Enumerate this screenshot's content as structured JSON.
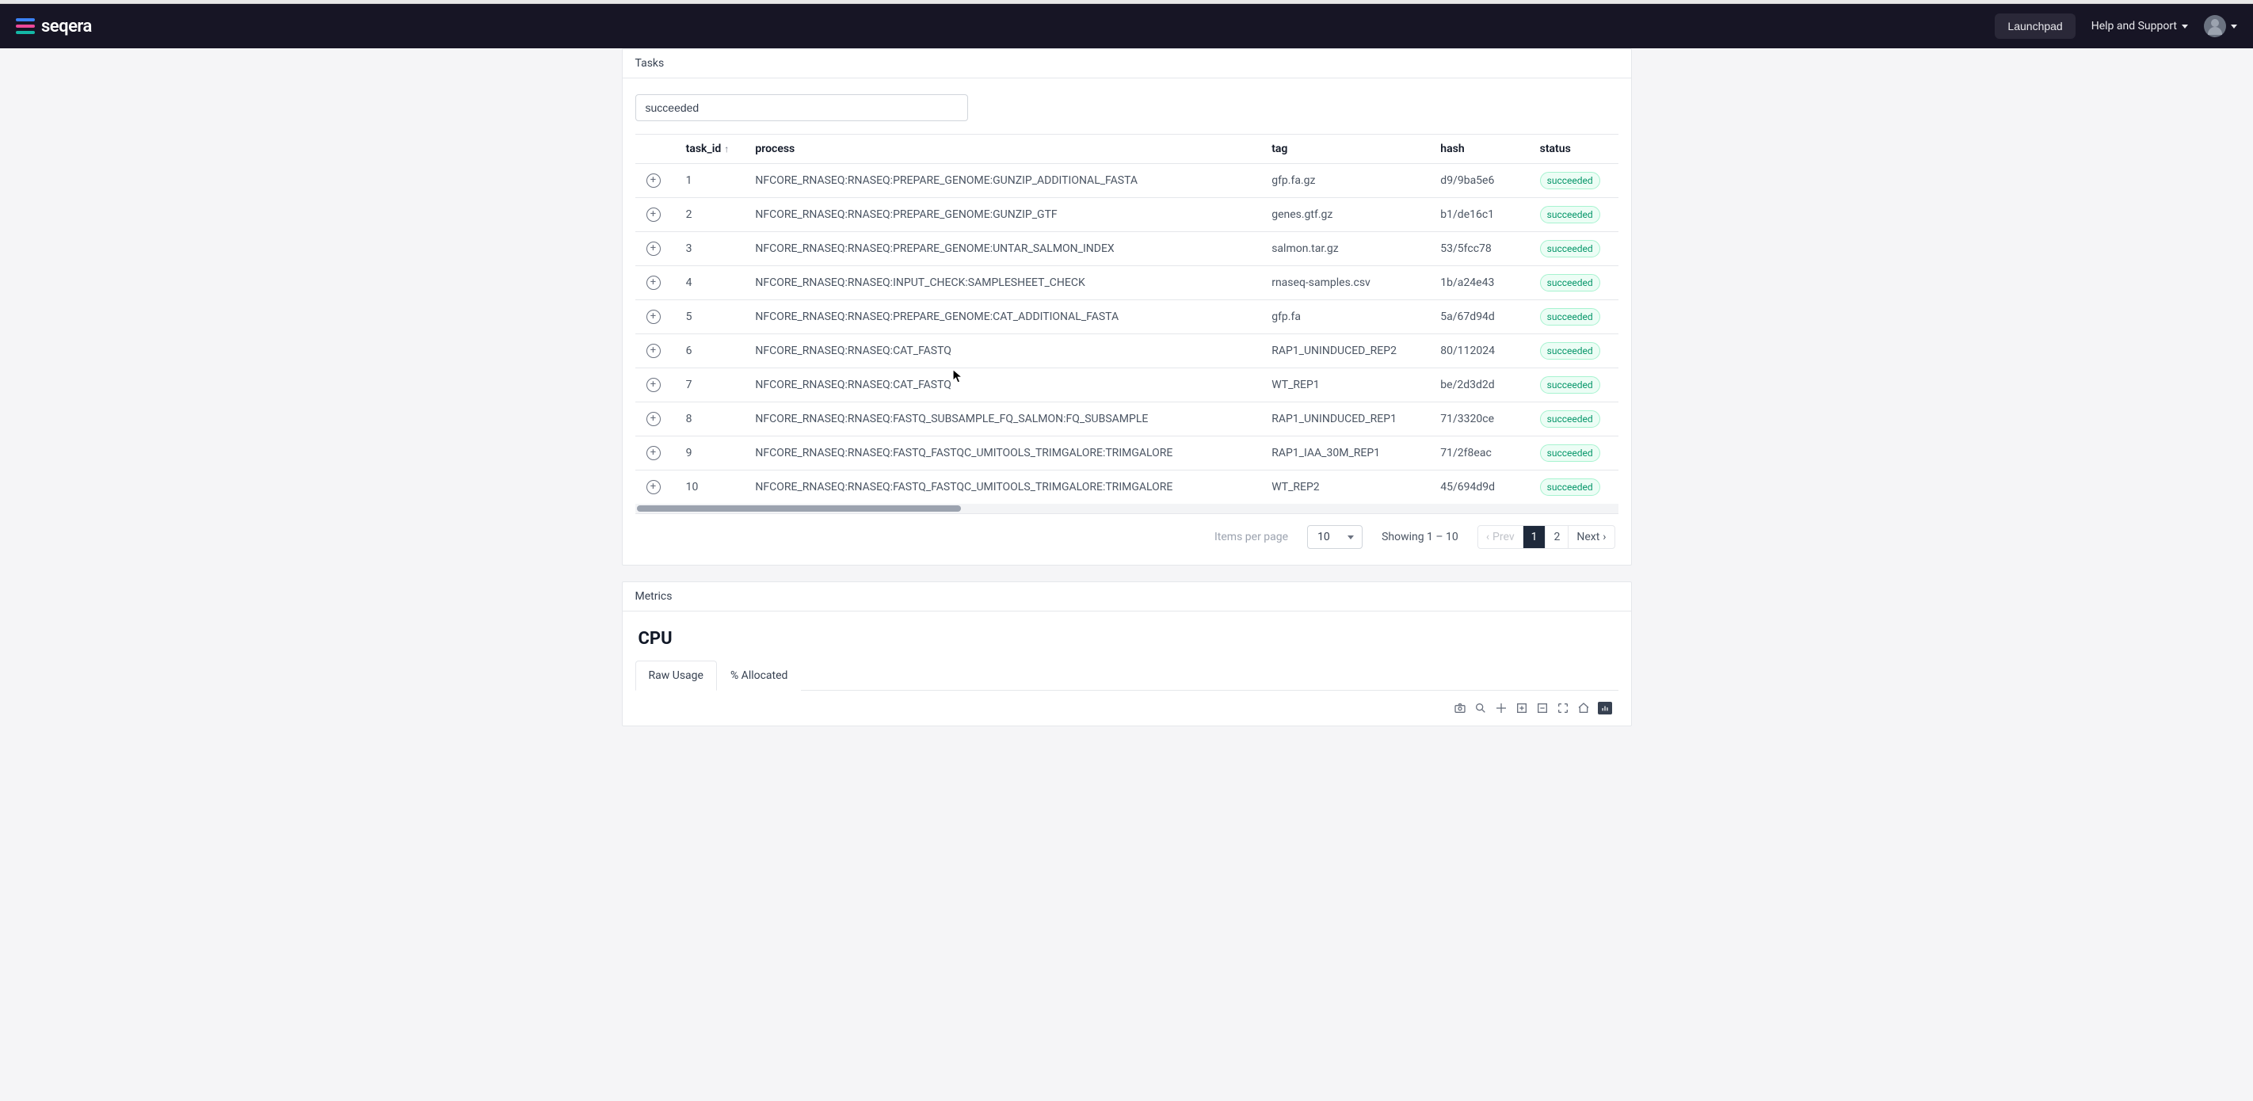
{
  "brand": "seqera",
  "nav": {
    "launchpad": "Launchpad",
    "help": "Help and Support"
  },
  "tasks_card": {
    "title": "Tasks",
    "search_value": "succeeded",
    "columns": {
      "task_id": "task_id",
      "process": "process",
      "tag": "tag",
      "hash": "hash",
      "status": "status"
    },
    "rows": [
      {
        "id": "1",
        "process": "NFCORE_RNASEQ:RNASEQ:PREPARE_GENOME:GUNZIP_ADDITIONAL_FASTA",
        "tag": "gfp.fa.gz",
        "hash": "d9/9ba5e6",
        "status": "succeeded"
      },
      {
        "id": "2",
        "process": "NFCORE_RNASEQ:RNASEQ:PREPARE_GENOME:GUNZIP_GTF",
        "tag": "genes.gtf.gz",
        "hash": "b1/de16c1",
        "status": "succeeded"
      },
      {
        "id": "3",
        "process": "NFCORE_RNASEQ:RNASEQ:PREPARE_GENOME:UNTAR_SALMON_INDEX",
        "tag": "salmon.tar.gz",
        "hash": "53/5fcc78",
        "status": "succeeded"
      },
      {
        "id": "4",
        "process": "NFCORE_RNASEQ:RNASEQ:INPUT_CHECK:SAMPLESHEET_CHECK",
        "tag": "rnaseq-samples.csv",
        "hash": "1b/a24e43",
        "status": "succeeded"
      },
      {
        "id": "5",
        "process": "NFCORE_RNASEQ:RNASEQ:PREPARE_GENOME:CAT_ADDITIONAL_FASTA",
        "tag": "gfp.fa",
        "hash": "5a/67d94d",
        "status": "succeeded"
      },
      {
        "id": "6",
        "process": "NFCORE_RNASEQ:RNASEQ:CAT_FASTQ",
        "tag": "RAP1_UNINDUCED_REP2",
        "hash": "80/112024",
        "status": "succeeded"
      },
      {
        "id": "7",
        "process": "NFCORE_RNASEQ:RNASEQ:CAT_FASTQ",
        "tag": "WT_REP1",
        "hash": "be/2d3d2d",
        "status": "succeeded"
      },
      {
        "id": "8",
        "process": "NFCORE_RNASEQ:RNASEQ:FASTQ_SUBSAMPLE_FQ_SALMON:FQ_SUBSAMPLE",
        "tag": "RAP1_UNINDUCED_REP1",
        "hash": "71/3320ce",
        "status": "succeeded"
      },
      {
        "id": "9",
        "process": "NFCORE_RNASEQ:RNASEQ:FASTQ_FASTQC_UMITOOLS_TRIMGALORE:TRIMGALORE",
        "tag": "RAP1_IAA_30M_REP1",
        "hash": "71/2f8eac",
        "status": "succeeded"
      },
      {
        "id": "10",
        "process": "NFCORE_RNASEQ:RNASEQ:FASTQ_FASTQC_UMITOOLS_TRIMGALORE:TRIMGALORE",
        "tag": "WT_REP2",
        "hash": "45/694d9d",
        "status": "succeeded"
      }
    ],
    "pagination": {
      "ipp_label": "Items per page",
      "ipp_value": "10",
      "showing": "Showing 1 – 10",
      "prev": "Prev",
      "next": "Next",
      "page1": "1",
      "page2": "2"
    }
  },
  "metrics_card": {
    "title": "Metrics",
    "section": "CPU",
    "tabs": {
      "raw": "Raw Usage",
      "allocated": "% Allocated"
    }
  }
}
